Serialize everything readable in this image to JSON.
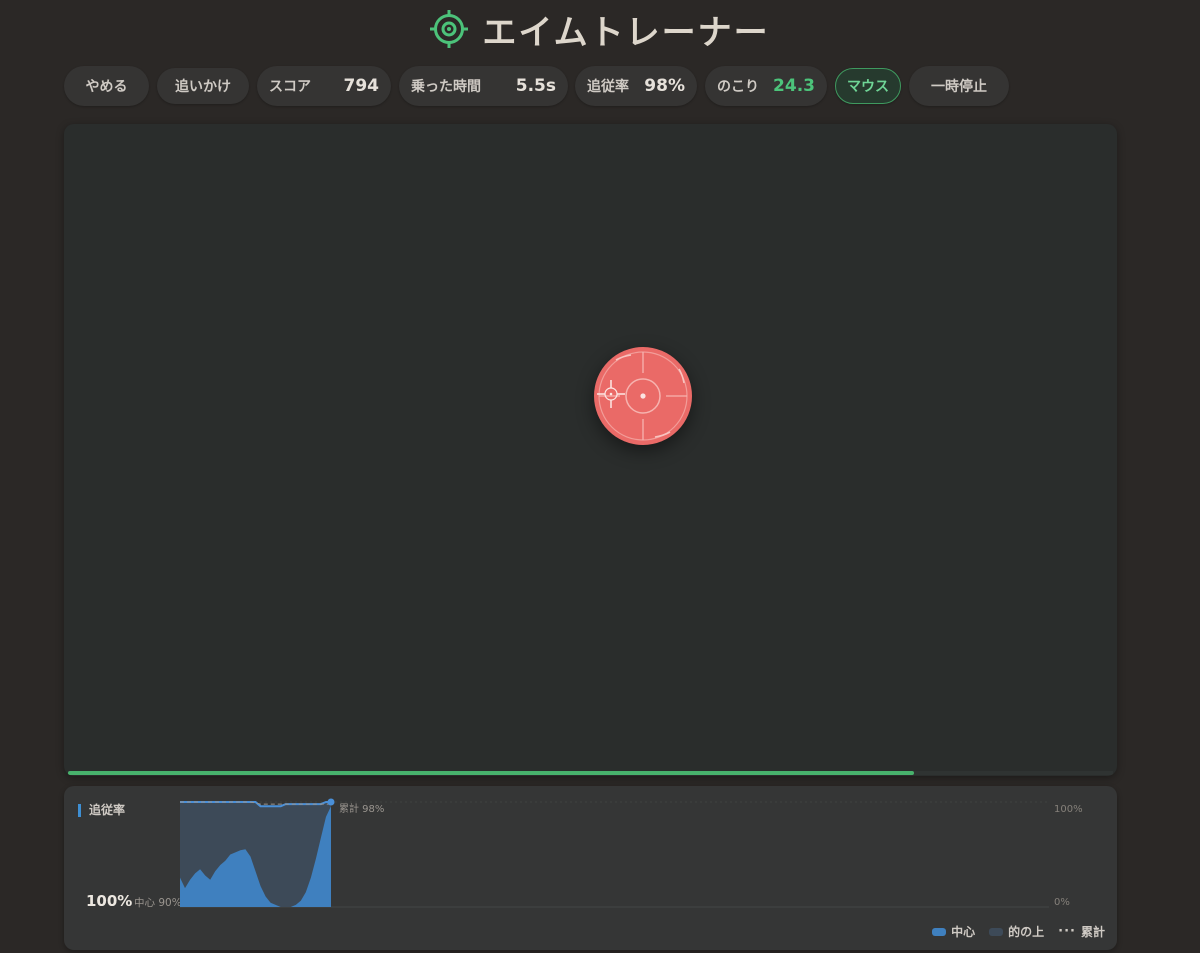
{
  "app": {
    "title": "エイムトレーナー",
    "title_icon": "crosshair-target-icon",
    "accent": "#4cc37a"
  },
  "toolbar": {
    "quit_label": "やめる",
    "chase_label": "追いかけ",
    "score_label": "スコア",
    "score_value": "794",
    "ride_time_label": "乗った時間",
    "ride_time_value": "5.5s",
    "tracking_label": "追従率",
    "tracking_value": "98%",
    "remaining_label": "のこり",
    "remaining_value": "24.3",
    "mode_label": "マウス",
    "pause_label": "一時停止"
  },
  "arena": {
    "progress": 0.81,
    "target_color": "#ea6a67",
    "progress_color": "#48b16c"
  },
  "chart": {
    "label": "追従率",
    "current_value": "100%",
    "center_note": "中心 90%",
    "cumulative_note": "累計 98%",
    "y_max_label": "100%",
    "y_min_label": "0%",
    "legend": {
      "center": "中心",
      "on_target": "的の上",
      "cumulative": "累計"
    }
  },
  "chart_data": {
    "type": "area",
    "ylim": [
      0,
      100
    ],
    "series": [
      {
        "name": "中心",
        "color": "#3f80bf",
        "values": [
          28,
          18,
          26,
          32,
          36,
          30,
          26,
          34,
          40,
          44,
          50,
          52,
          54,
          55,
          48,
          34,
          20,
          10,
          4,
          2,
          0,
          0,
          0,
          2,
          6,
          14,
          28,
          46,
          66,
          86,
          96
        ]
      },
      {
        "name": "的の上",
        "color": "#3d4a58",
        "values": [
          100,
          100,
          100,
          100,
          100,
          100,
          100,
          100,
          100,
          100,
          100,
          100,
          100,
          100,
          100,
          100,
          96,
          96,
          96,
          96,
          96,
          98,
          98,
          98,
          98,
          98,
          98,
          98,
          98,
          100,
          100
        ]
      },
      {
        "name": "累計",
        "color": "#9a958f",
        "values": [
          100,
          100,
          100,
          100,
          100,
          100,
          100,
          100,
          100,
          100,
          100,
          100,
          100,
          100,
          100,
          99,
          98,
          98,
          98,
          98,
          98,
          98,
          98,
          98,
          98,
          98,
          98,
          98,
          98,
          98,
          98
        ]
      }
    ]
  }
}
